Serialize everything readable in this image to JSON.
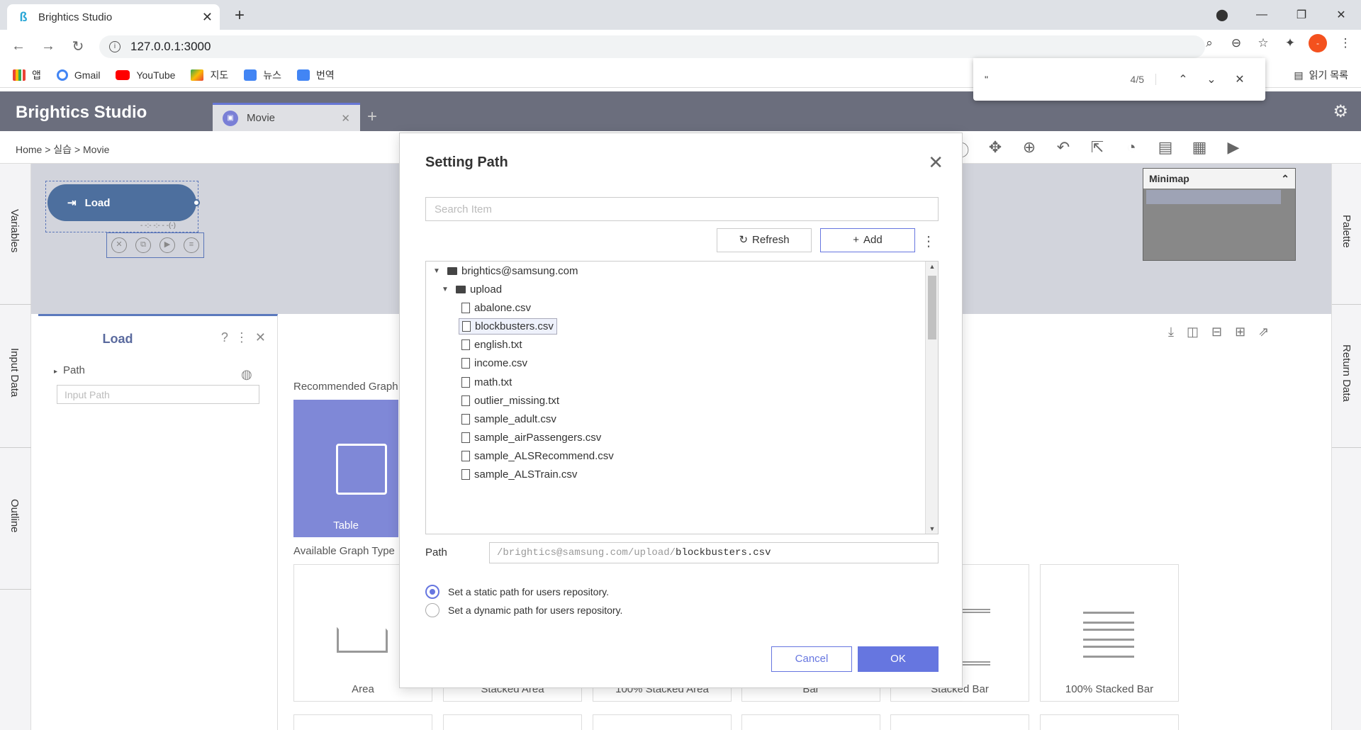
{
  "browser": {
    "tab_title": "Brightics Studio",
    "url": "127.0.0.1:3000",
    "bookmarks": [
      "앱",
      "Gmail",
      "YouTube",
      "지도",
      "뉴스",
      "번역"
    ],
    "reading_list": "읽기 목록",
    "find": {
      "query": "\"",
      "count": "4/5"
    }
  },
  "app": {
    "brand": "Brightics Studio",
    "tab": "Movie",
    "breadcrumb": "Home > 실습 > Movie",
    "node_label": "Load",
    "node_sub": "- -:- -:- - -(-)",
    "minimap_title": "Minimap",
    "rails": {
      "left": [
        "Variables",
        "Input Data",
        "Outline"
      ],
      "right": [
        "Palette",
        "Return Data"
      ]
    }
  },
  "panel": {
    "title": "Load",
    "property": "Path",
    "input_placeholder": "Input Path"
  },
  "main": {
    "recommended_label": "Recommended Graph",
    "table_card": "Table",
    "available_label": "Available Graph Type",
    "graph_types": [
      "Area",
      "Stacked Area",
      "100% Stacked Area",
      "Bar",
      "Stacked Bar",
      "100% Stacked Bar"
    ]
  },
  "modal": {
    "title": "Setting Path",
    "search_placeholder": "Search Item",
    "refresh": "Refresh",
    "add": "Add",
    "root": "brightics@samsung.com",
    "folder": "upload",
    "files": [
      "abalone.csv",
      "blockbusters.csv",
      "english.txt",
      "income.csv",
      "math.txt",
      "outlier_missing.txt",
      "sample_adult.csv",
      "sample_airPassengers.csv",
      "sample_ALSRecommend.csv",
      "sample_ALSTrain.csv"
    ],
    "selected_file": "blockbusters.csv",
    "path_label": "Path",
    "path_prefix": "/brightics@samsung.com/upload/",
    "path_file": "blockbusters.csv",
    "radio_static": "Set a static path for users repository.",
    "radio_dynamic": "Set a dynamic path for users repository.",
    "cancel": "Cancel",
    "ok": "OK"
  },
  "colors": {
    "accent": "#6676e0",
    "header": "#6b6e7d",
    "node": "#4d6f9e",
    "table_card": "#7f88d7"
  }
}
